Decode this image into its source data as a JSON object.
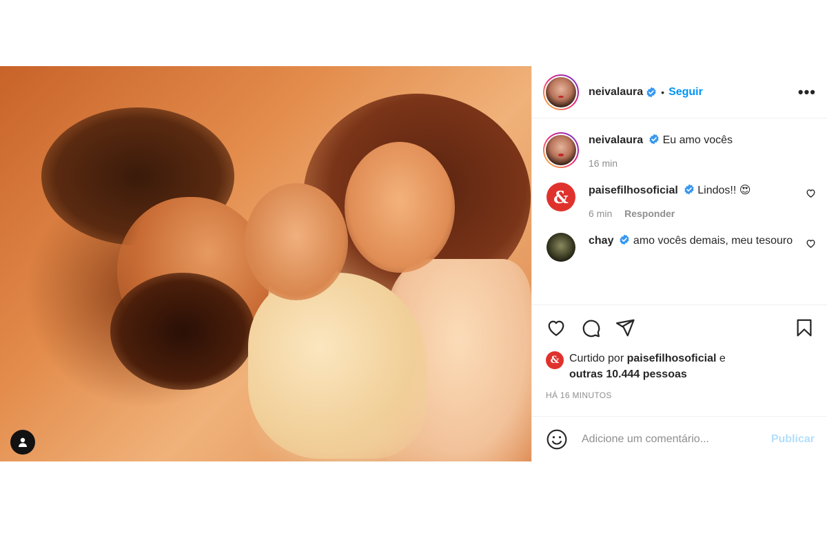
{
  "header": {
    "username": "neivalaura",
    "separator": "•",
    "follow_label": "Seguir",
    "more_label": "•••"
  },
  "comments": [
    {
      "username": "neivalaura",
      "text": "Eu amo vocês",
      "time": "16 min",
      "reply_label": ""
    },
    {
      "username": "paisefilhosoficial",
      "text": "Lindos!! 😍",
      "time": "6 min",
      "reply_label": "Responder",
      "avatar_glyph": "&"
    },
    {
      "username": "chay",
      "text": "amo vocês demais, meu tesouro"
    }
  ],
  "likes": {
    "prefix": "Curtido por",
    "liker": "paisefilhosoficial",
    "suffix": "e",
    "others": "outras 10.444 pessoas",
    "avatar_glyph": "&"
  },
  "timestamp": "HÁ 16 MINUTOS",
  "comment_input": {
    "placeholder": "Adicione um comentário...",
    "publish_label": "Publicar"
  },
  "colors": {
    "link_blue": "#0095f6",
    "publish_disabled": "#b2dffc",
    "brand_red": "#e0322d",
    "muted_text": "#8e8e8e"
  },
  "icons": [
    "person-tag-icon",
    "verified-badge-icon",
    "like-heart-icon",
    "comment-bubble-icon",
    "share-paper-plane-icon",
    "save-bookmark-icon",
    "emoji-icon"
  ]
}
